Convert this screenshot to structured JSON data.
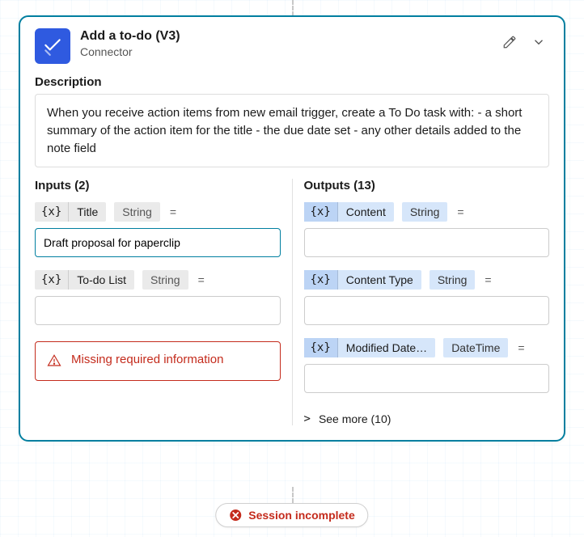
{
  "header": {
    "title": "Add a to-do (V3)",
    "subtitle": "Connector"
  },
  "description": {
    "label": "Description",
    "text": "When you receive action items from new email trigger, create a To Do task with: - a short summary of the action item for the title - the due date set - any other details added to the note field"
  },
  "inputs": {
    "label": "Inputs (2)",
    "params": [
      {
        "brace": "{x}",
        "name": "Title",
        "type": "String",
        "eq": "=",
        "value": "Draft proposal for paperclip"
      },
      {
        "brace": "{x}",
        "name": "To-do List",
        "type": "String",
        "eq": "=",
        "value": ""
      }
    ],
    "error": "Missing required information"
  },
  "outputs": {
    "label": "Outputs (13)",
    "params": [
      {
        "brace": "{x}",
        "name": "Content",
        "type": "String",
        "eq": "=",
        "value": ""
      },
      {
        "brace": "{x}",
        "name": "Content Type",
        "type": "String",
        "eq": "=",
        "value": ""
      },
      {
        "brace": "{x}",
        "name": "Modified Date…",
        "type": "DateTime",
        "eq": "=",
        "value": ""
      }
    ],
    "see_more": {
      "chevron": ">",
      "label": "See more (10)"
    }
  },
  "session": {
    "label": "Session incomplete"
  }
}
